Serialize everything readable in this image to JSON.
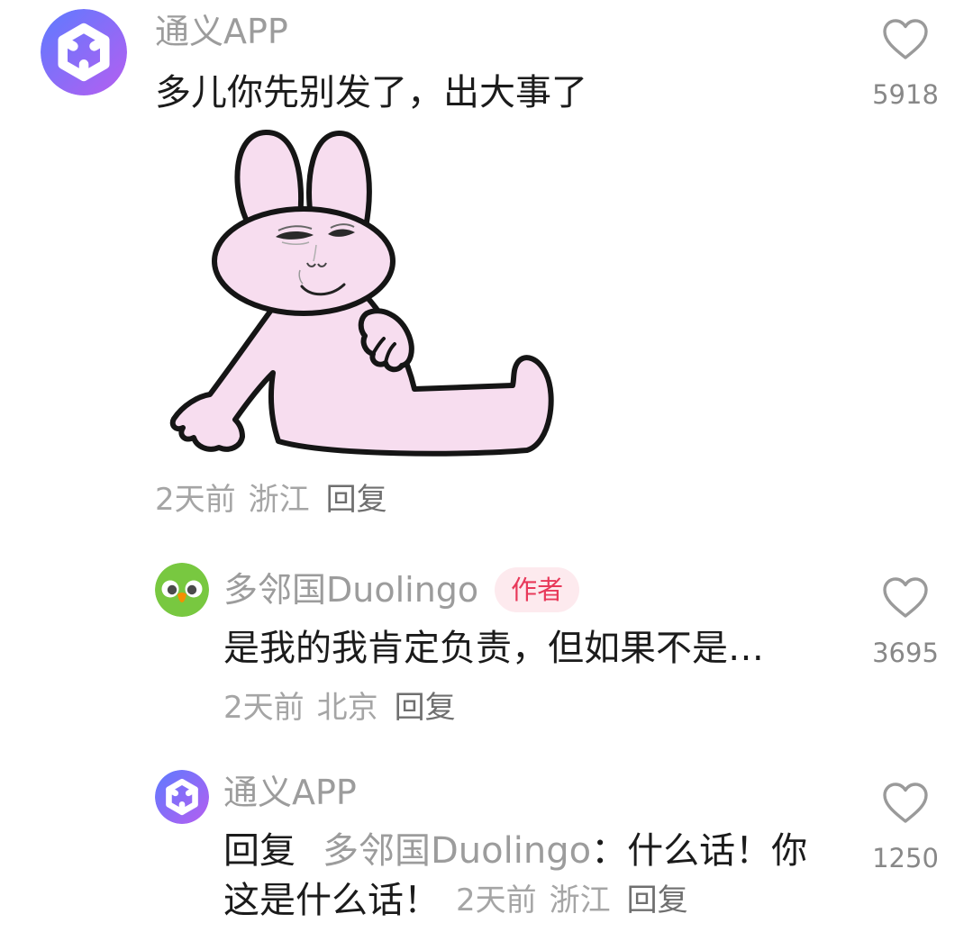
{
  "colors": {
    "background": "#ffffff",
    "text": "#1b1b1b",
    "username": "#9c9c9c",
    "meta": "#a5a5a5",
    "meta_action": "#6f6f6f",
    "like_icon": "#9a9a9a",
    "like_count": "#888888",
    "badge_text": "#e8395a",
    "badge_bg": "#fdeaee",
    "tongyi_start": "#5d7bff",
    "tongyi_end": "#b65ef0",
    "duolingo_green": "#78c840",
    "sticker_fill": "#f7ddef"
  },
  "comment": {
    "avatar_icon": "tongyi-logo-icon",
    "username": "通义APP",
    "text": "多儿你先别发了，出大事了",
    "sticker_icon": "pink-bunny-sticker",
    "time": "2天前",
    "location": "浙江",
    "reply_label": "回复",
    "like_icon": "heart-outline-icon",
    "likes": 5918
  },
  "replies": [
    {
      "avatar_icon": "duolingo-owl-icon",
      "username": "多邻国Duolingo",
      "badge": "作者",
      "text": "是我的我肯定负责，但如果不是…",
      "time": "2天前",
      "location": "北京",
      "reply_label": "回复",
      "like_icon": "heart-outline-icon",
      "likes": 3695
    },
    {
      "avatar_icon": "tongyi-logo-icon",
      "username": "通义APP",
      "reply_prefix": "回复",
      "mention": "多邻国Duolingo",
      "text_line1": "：什么话！你",
      "text_line2": "这是什么话！",
      "time": "2天前",
      "location": "浙江",
      "reply_label": "回复",
      "like_icon": "heart-outline-icon",
      "likes": 1250
    }
  ]
}
